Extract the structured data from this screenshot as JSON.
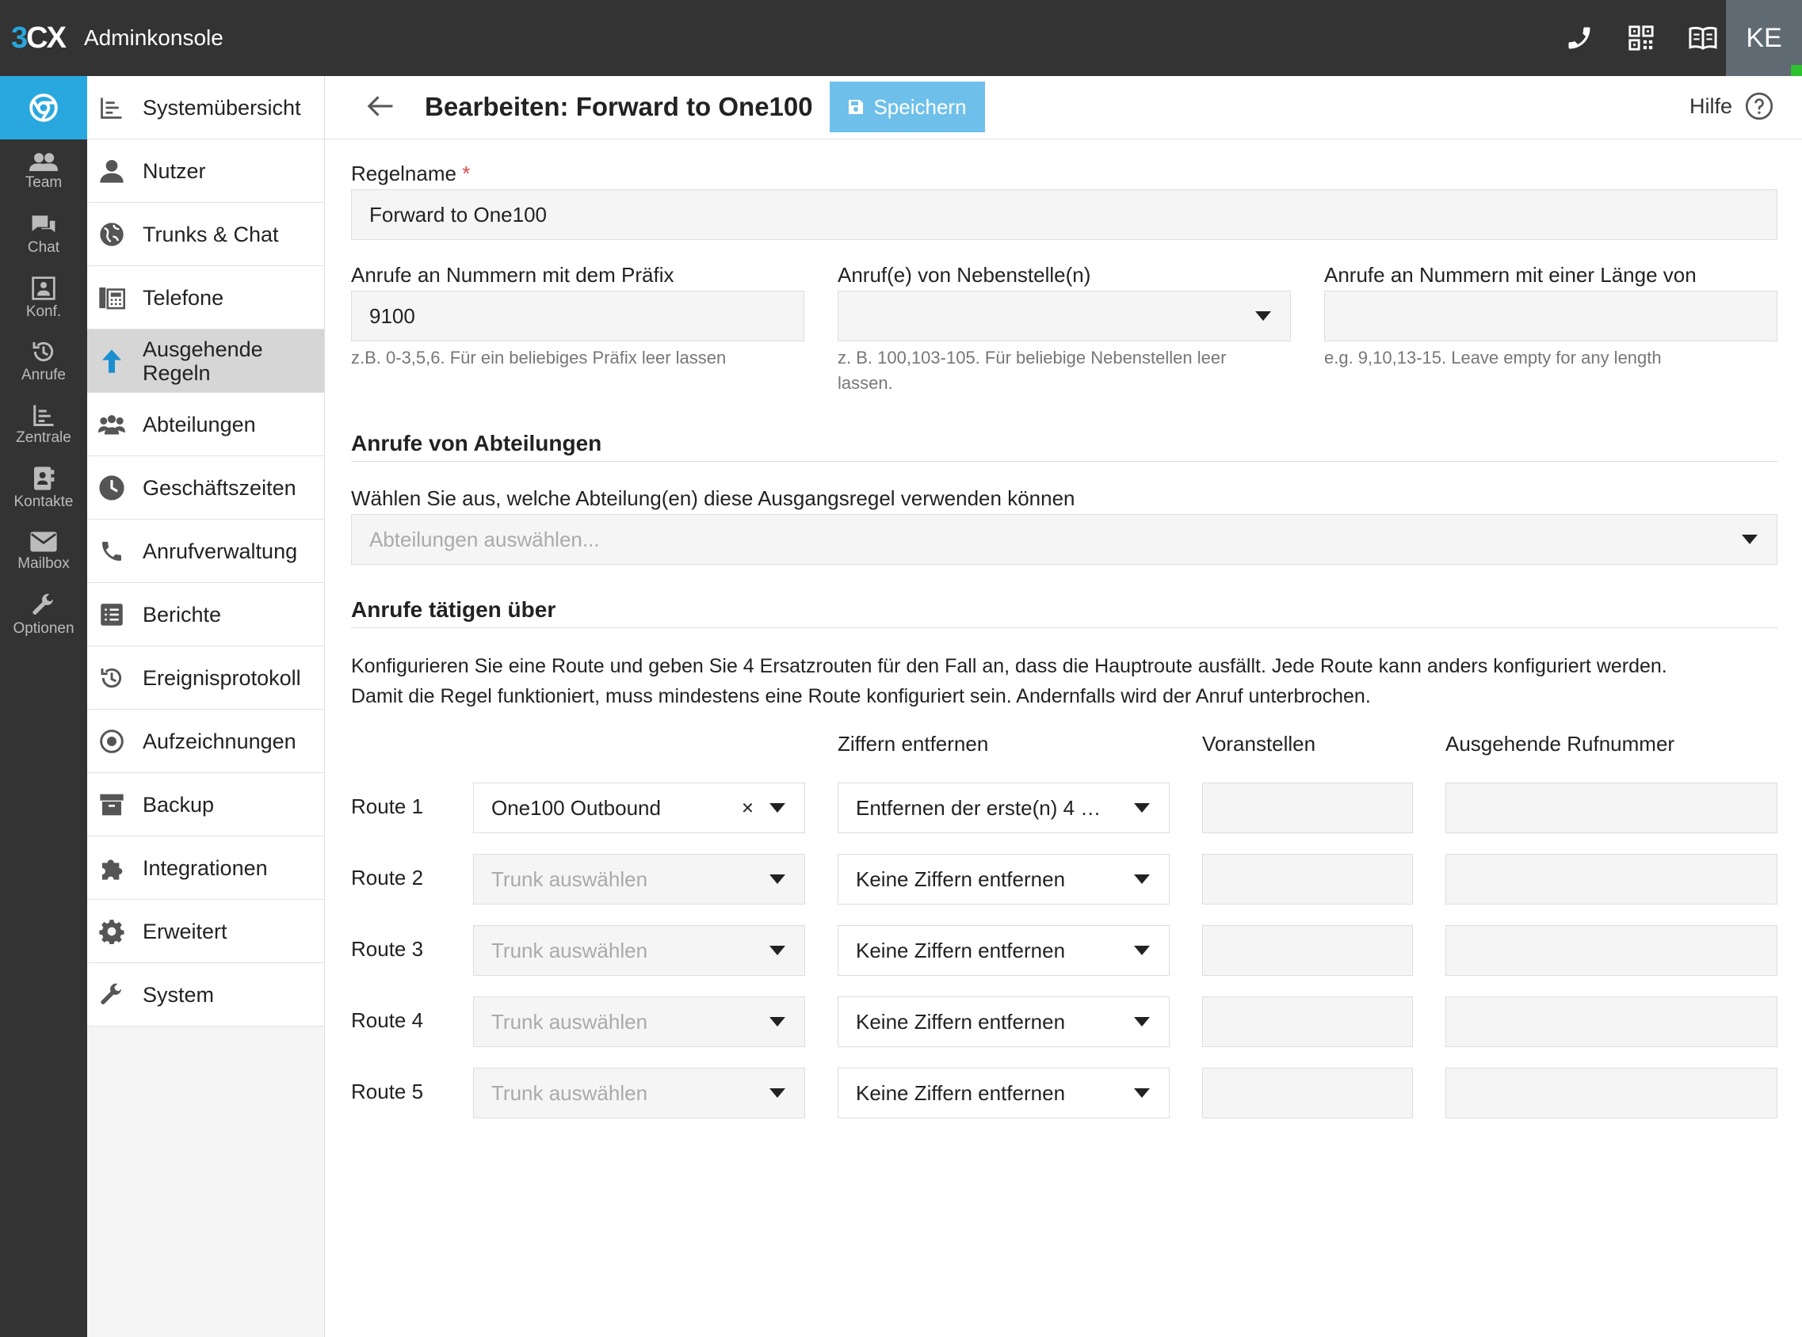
{
  "app": {
    "logo_3": "3",
    "logo_cx": "CX",
    "title": "Adminkonsole",
    "user_initials": "KE"
  },
  "topbar_icons": [
    "phone-icon",
    "qr-code-icon",
    "book-icon"
  ],
  "rail": {
    "items": [
      {
        "label": "Team",
        "icon": "team-icon"
      },
      {
        "label": "Chat",
        "icon": "chat-icon"
      },
      {
        "label": "Konf.",
        "icon": "conference-icon"
      },
      {
        "label": "Anrufe",
        "icon": "history-icon"
      },
      {
        "label": "Zentrale",
        "icon": "switchboard-icon"
      },
      {
        "label": "Kontakte",
        "icon": "contacts-icon"
      },
      {
        "label": "Mailbox",
        "icon": "mail-icon"
      },
      {
        "label": "Optionen",
        "icon": "wrench-icon"
      }
    ]
  },
  "menu": {
    "items": [
      {
        "label": "Systemübersicht"
      },
      {
        "label": "Nutzer"
      },
      {
        "label": "Trunks & Chat"
      },
      {
        "label": "Telefone"
      },
      {
        "label": "Ausgehende Regeln"
      },
      {
        "label": "Abteilungen"
      },
      {
        "label": "Geschäftszeiten"
      },
      {
        "label": "Anrufverwaltung"
      },
      {
        "label": "Berichte"
      },
      {
        "label": "Ereignisprotokoll"
      },
      {
        "label": "Aufzeichnungen"
      },
      {
        "label": "Backup"
      },
      {
        "label": "Integrationen"
      },
      {
        "label": "Erweitert"
      },
      {
        "label": "System"
      }
    ],
    "active": "Ausgehende Regeln"
  },
  "header": {
    "title": "Bearbeiten: Forward to One100",
    "save_label": "Speichern",
    "help_label": "Hilfe"
  },
  "form": {
    "rule_name_label": "Regelname",
    "rule_name_required": "*",
    "rule_name_value": "Forward to One100",
    "prefix_label": "Anrufe an Nummern mit dem Präfix",
    "prefix_value": "9100",
    "prefix_hint": "z.B. 0-3,5,6. Für ein beliebiges Präfix leer lassen",
    "ext_label": "Anruf(e) von Nebenstelle(n)",
    "ext_hint_1": "z. B. 100,103-105. Für beliebige Nebenstellen leer",
    "ext_hint_2": "lassen.",
    "length_label": "Anrufe an Nummern mit einer Länge von",
    "length_hint": "e.g. 9,10,13-15. Leave empty for any length"
  },
  "departments": {
    "section_title": "Anrufe von Abteilungen",
    "label": "Wählen Sie aus, welche Abteilung(en) diese Ausgangsregel verwenden können",
    "placeholder": "Abteilungen auswählen..."
  },
  "routes": {
    "section_title": "Anrufe tätigen über",
    "desc_1": "Konfigurieren Sie eine Route und geben Sie 4 Ersatzrouten für den Fall an, dass die Hauptroute ausfällt. Jede Route kann anders konfiguriert werden.",
    "desc_2": "Damit die Regel funktioniert, muss mindestens eine Route konfiguriert sein. Andernfalls wird der Anruf unterbrochen.",
    "col_strip": "Ziffern entfernen",
    "col_prepend": "Voranstellen",
    "col_outbound": "Ausgehende Rufnummer",
    "rows": [
      {
        "label": "Route 1",
        "trunk": "One100 Outbound",
        "trunk_placeholder": "",
        "clear": "×",
        "strip": "Entfernen der erste(n) 4 …",
        "prepend": "",
        "outbound": ""
      },
      {
        "label": "Route 2",
        "trunk": "",
        "trunk_placeholder": "Trunk auswählen",
        "strip": "Keine Ziffern entfernen",
        "prepend": "",
        "outbound": ""
      },
      {
        "label": "Route 3",
        "trunk": "",
        "trunk_placeholder": "Trunk auswählen",
        "strip": "Keine Ziffern entfernen",
        "prepend": "",
        "outbound": ""
      },
      {
        "label": "Route 4",
        "trunk": "",
        "trunk_placeholder": "Trunk auswählen",
        "strip": "Keine Ziffern entfernen",
        "prepend": "",
        "outbound": ""
      },
      {
        "label": "Route 5",
        "trunk": "",
        "trunk_placeholder": "Trunk auswählen",
        "strip": "Keine Ziffern entfernen",
        "prepend": "",
        "outbound": ""
      }
    ]
  },
  "colors": {
    "topbar": "#333333",
    "accent": "#29a8e0",
    "save_button": "#6ec0ea",
    "active_menu": "#d6d6d6",
    "user_tile": "#5f6a73",
    "status_online": "#2ec12e"
  }
}
